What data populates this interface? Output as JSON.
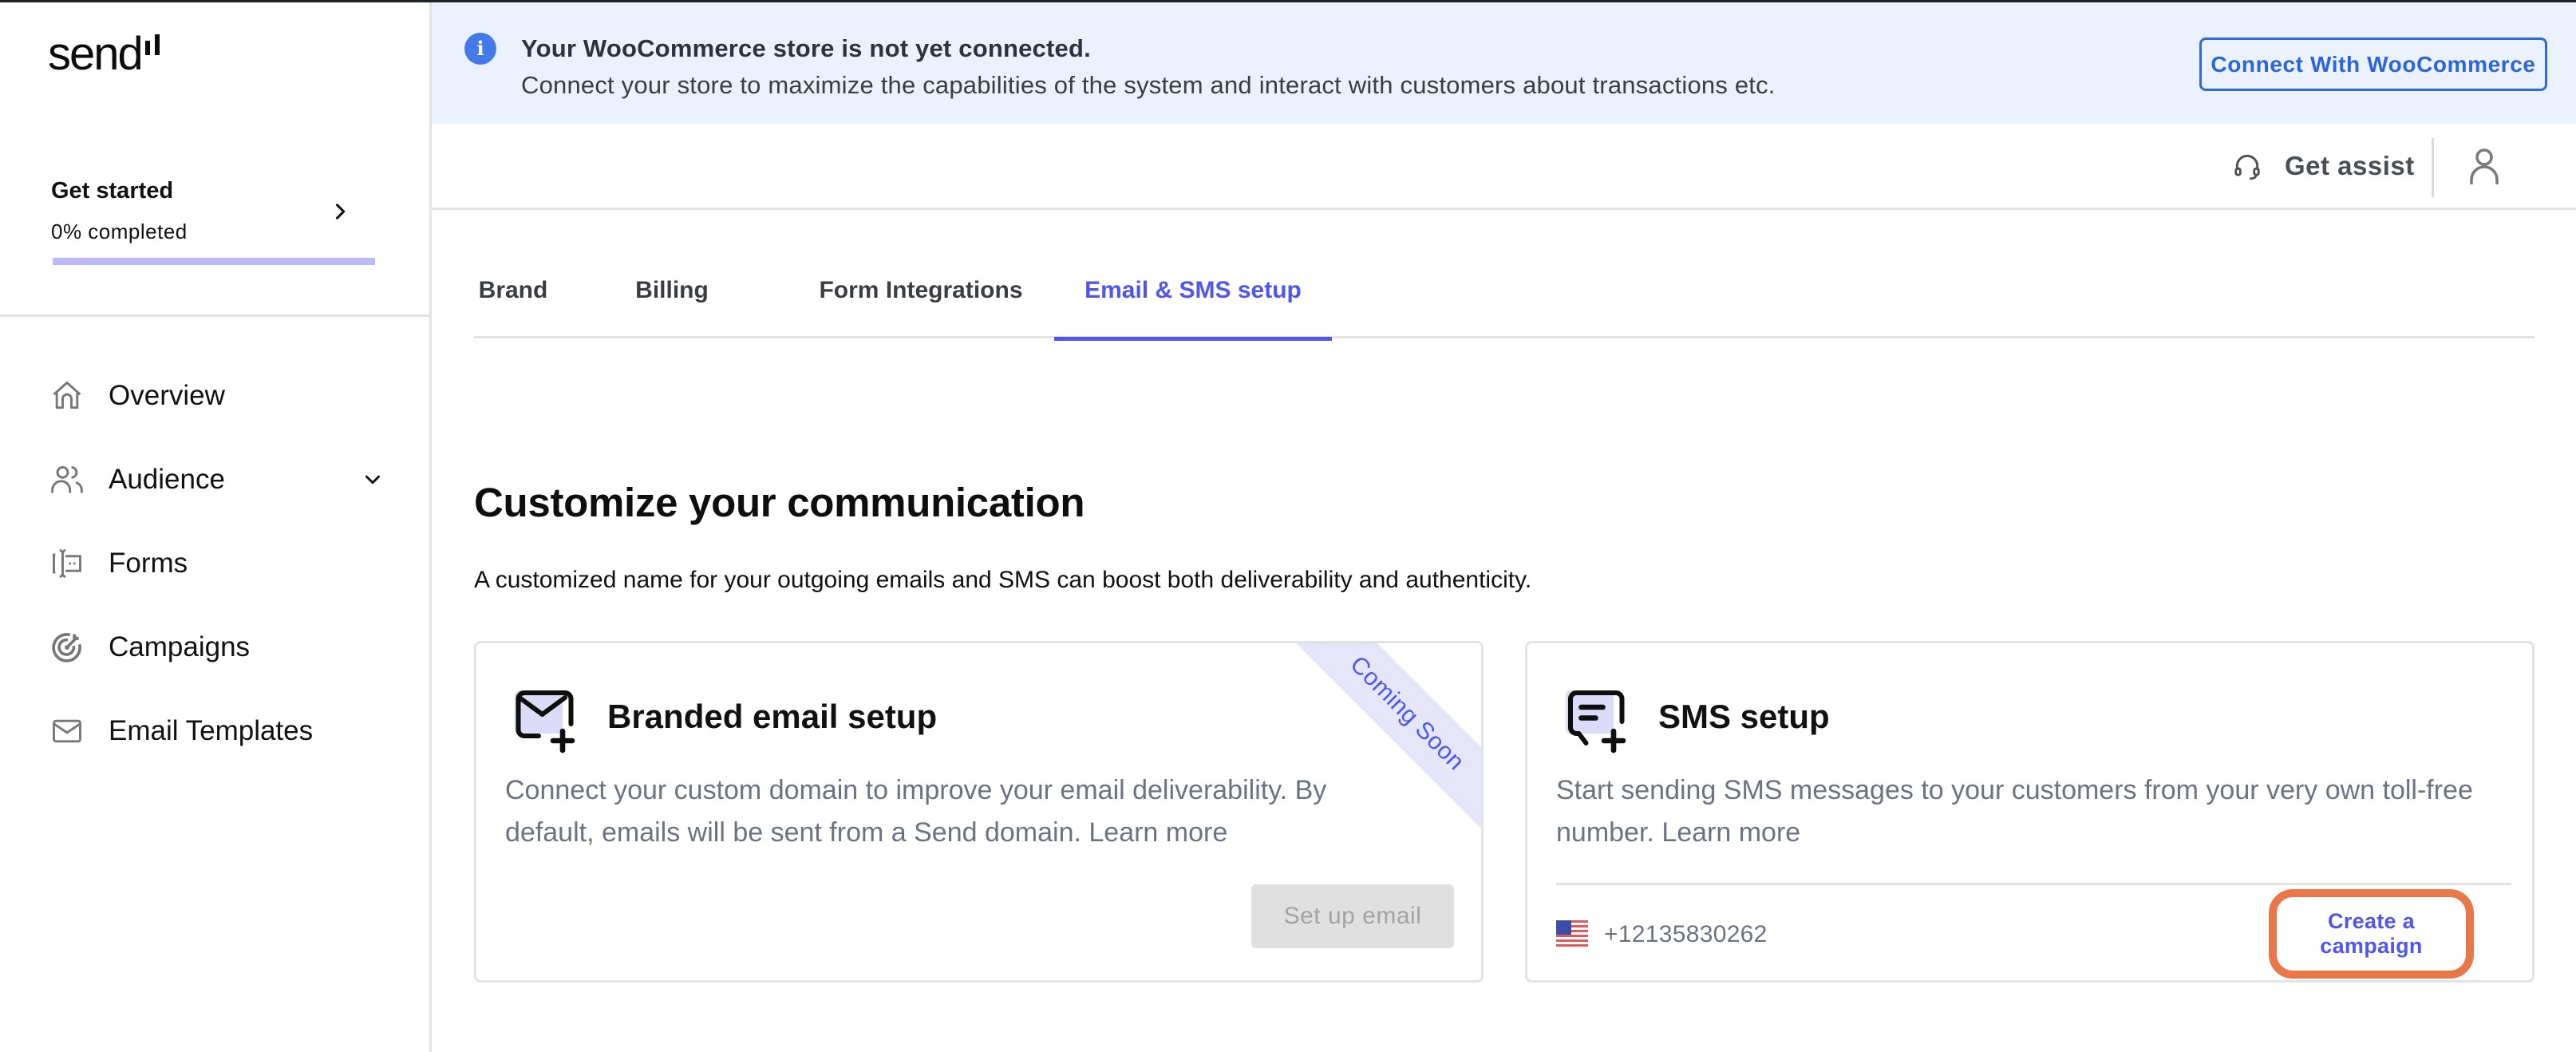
{
  "app": {
    "logo_text": "send"
  },
  "sidebar": {
    "get_started": {
      "title": "Get started",
      "progress_label": "0% completed",
      "progress_percent": 0
    },
    "items": [
      {
        "label": "Overview",
        "icon": "home-icon"
      },
      {
        "label": "Audience",
        "icon": "users-icon",
        "has_dropdown": true
      },
      {
        "label": "Forms",
        "icon": "form-icon"
      },
      {
        "label": "Campaigns",
        "icon": "target-icon"
      },
      {
        "label": "Email Templates",
        "icon": "mail-icon"
      }
    ]
  },
  "banner": {
    "title": "Your WooCommerce store is not yet connected.",
    "text": "Connect your store to maximize the capabilities of the system and interact with customers about transactions etc.",
    "button_label": "Connect With WooCommerce",
    "icon": "info-icon"
  },
  "header": {
    "assist_label": "Get assist",
    "assist_icon": "headset-icon",
    "user_icon": "user-icon"
  },
  "tabs": [
    {
      "label": "Brand",
      "active": false
    },
    {
      "label": "Billing",
      "active": false
    },
    {
      "label": "Form Integrations",
      "active": false
    },
    {
      "label": "Email & SMS setup",
      "active": true
    }
  ],
  "main": {
    "title": "Customize your communication",
    "subtitle": "A customized name for your outgoing emails and SMS can boost both deliverability and authenticity.",
    "cards": {
      "email": {
        "title": "Branded email setup",
        "description": "Connect your custom domain to improve your email deliverability. By default, emails will be sent from a Send domain.",
        "learn_more": "Learn more",
        "ribbon": "Coming Soon",
        "button_label": "Set up email",
        "button_disabled": true
      },
      "sms": {
        "title": "SMS setup",
        "description": "Start sending SMS messages to your customers from your very own toll-free number.",
        "learn_more": "Learn more",
        "phone_number": "+12135830262",
        "country_flag": "us-flag-icon",
        "button_label": "Create a campaign"
      }
    }
  },
  "colors": {
    "accent": "#4f55ef",
    "banner_bg": "#ebf1fd",
    "banner_button": "#2f6ae0",
    "info_icon": "#4479e8",
    "progress_track": "#bbbaf7",
    "highlight_outline": "#e8784a",
    "muted_text": "#6b7280"
  }
}
